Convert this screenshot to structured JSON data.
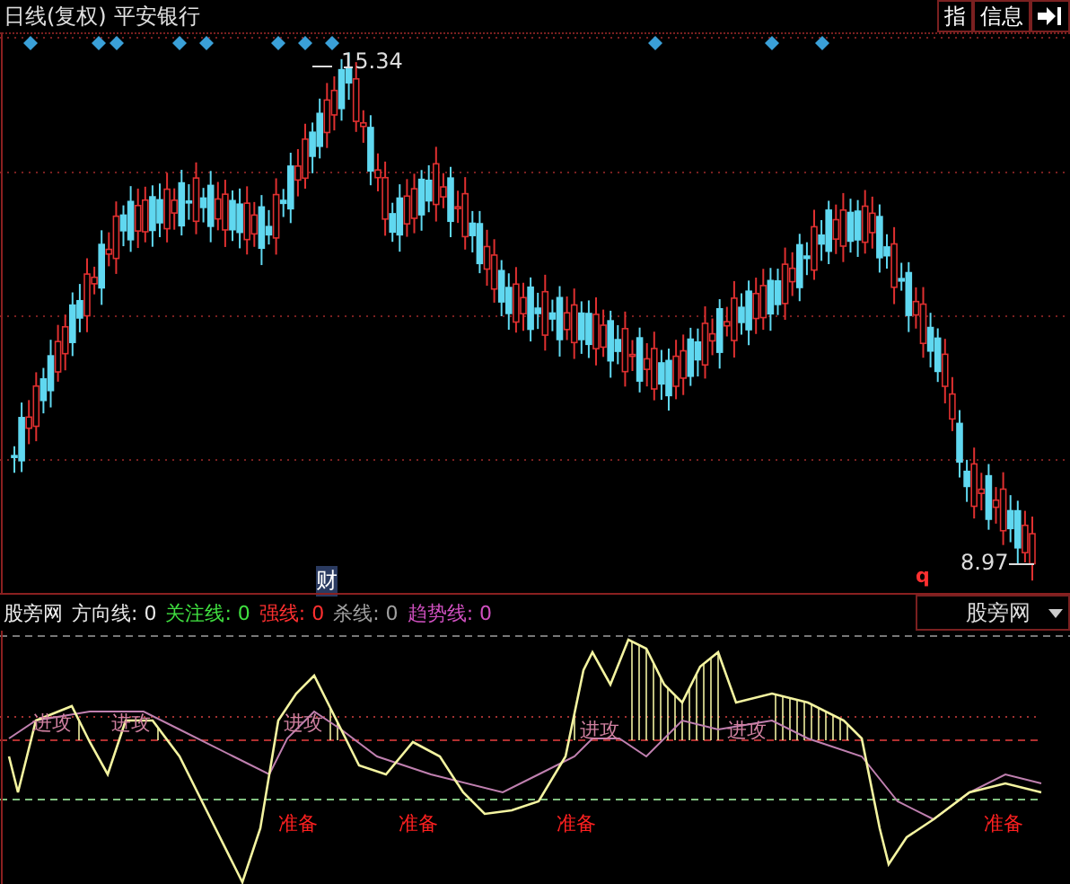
{
  "header": {
    "period": "日线(复权)",
    "stock": "平安银行"
  },
  "toolbar": [
    {
      "label": "指",
      "kind": "text"
    },
    {
      "label": "信息",
      "kind": "text"
    },
    {
      "kind": "arrow"
    }
  ],
  "price_chart": {
    "high_label": "15.34",
    "low_label": "8.97",
    "badge": "财",
    "mark": "q"
  },
  "indicator": {
    "name": "股旁网",
    "lines": [
      {
        "label": "方向线: 0",
        "color": "#e8e8e8"
      },
      {
        "label": "关注线: 0",
        "color": "#40e040"
      },
      {
        "label": "强线: 0",
        "color": "#ff3030"
      },
      {
        "label": "杀线: 0",
        "color": "#a0a0a0"
      },
      {
        "label": "趋势线: 0",
        "color": "#d050c0"
      }
    ]
  },
  "selector": {
    "value": "股旁网"
  },
  "signals": [
    {
      "text": "进攻",
      "kind": "attack"
    },
    {
      "text": "进攻",
      "kind": "attack"
    },
    {
      "text": "进攻",
      "kind": "attack"
    },
    {
      "text": "进攻",
      "kind": "attack"
    },
    {
      "text": "进攻",
      "kind": "attack"
    },
    {
      "text": "准备",
      "kind": "ready"
    },
    {
      "text": "准备",
      "kind": "ready"
    },
    {
      "text": "准备",
      "kind": "ready"
    },
    {
      "text": "准备",
      "kind": "ready"
    }
  ]
}
